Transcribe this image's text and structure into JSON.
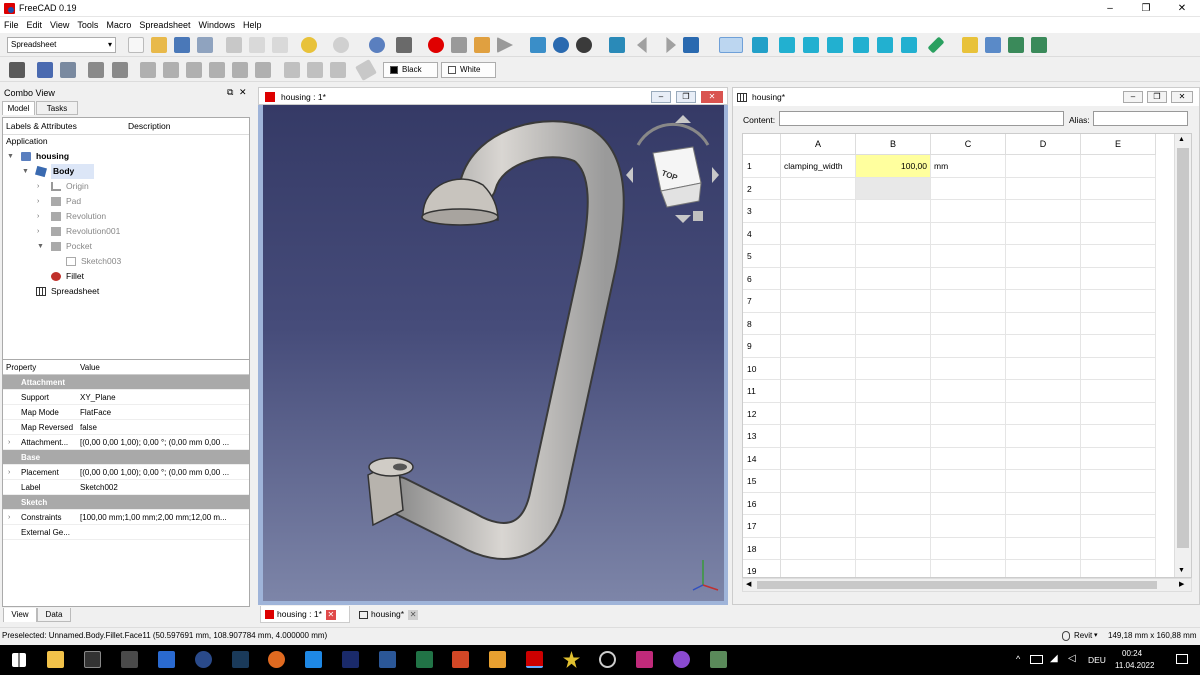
{
  "window": {
    "title": "FreeCAD 0.19",
    "minimize": "–",
    "maximize": "❐",
    "close": "✕"
  },
  "menu": [
    "File",
    "Edit",
    "View",
    "Tools",
    "Macro",
    "Spreadsheet",
    "Windows",
    "Help"
  ],
  "toolbar": {
    "workbench": "Spreadsheet",
    "color_black": "Black",
    "color_white": "White"
  },
  "combo": {
    "title": "Combo View",
    "tabs": [
      "Model",
      "Tasks"
    ],
    "tree_headers": [
      "Labels & Attributes",
      "Description"
    ],
    "tree_root": "Application",
    "tree": [
      "housing",
      "Body",
      "Origin",
      "Pad",
      "Revolution",
      "Revolution001",
      "Pocket",
      "Sketch003",
      "Fillet",
      "Spreadsheet"
    ],
    "bottom_tabs": [
      "View",
      "Data"
    ]
  },
  "properties": {
    "headers": [
      "Property",
      "Value"
    ],
    "rows": [
      {
        "group": "Attachment"
      },
      {
        "k": "Support",
        "v": "XY_Plane"
      },
      {
        "k": "Map Mode",
        "v": "FlatFace"
      },
      {
        "k": "Map Reversed",
        "v": "false"
      },
      {
        "k": "Attachment...",
        "v": "[(0,00 0,00 1,00); 0,00 °; (0,00 mm  0,00 ..."
      },
      {
        "group": "Base"
      },
      {
        "k": "Placement",
        "v": "[(0,00 0,00 1,00); 0,00 °; (0,00 mm  0,00 ..."
      },
      {
        "k": "Label",
        "v": "Sketch002"
      },
      {
        "group": "Sketch"
      },
      {
        "k": "Constraints",
        "v": "[100,00 mm;1,00 mm;2,00 mm;12,00 m..."
      },
      {
        "k": "External Ge...",
        "v": ""
      }
    ]
  },
  "view3d": {
    "title": "housing : 1*",
    "navcube_face": "TOP"
  },
  "sheet": {
    "title": "housing*",
    "content_label": "Content:",
    "alias_label": "Alias:",
    "columns": [
      "A",
      "B",
      "C",
      "D",
      "E"
    ],
    "rows": [
      "1",
      "2",
      "3",
      "4",
      "5",
      "6",
      "7",
      "8",
      "9",
      "10",
      "11",
      "12",
      "13",
      "14",
      "15",
      "16",
      "17",
      "18",
      "19"
    ],
    "cells": {
      "A1": "clamping_width",
      "B1": "100,00",
      "C1": "mm"
    },
    "highlight": "#ffff9e"
  },
  "doc_tabs": [
    "housing : 1*",
    "housing*"
  ],
  "status": {
    "text": "Preselected: Unnamed.Body.Fillet.Face11 (50.597691 mm, 108.907784 mm, 4.000000 mm)",
    "nav": "Revit",
    "dims": "149,18 mm x 160,88 mm"
  },
  "taskbar": {
    "lang": "DEU",
    "time": "00:24",
    "date": "11.04.2022"
  }
}
